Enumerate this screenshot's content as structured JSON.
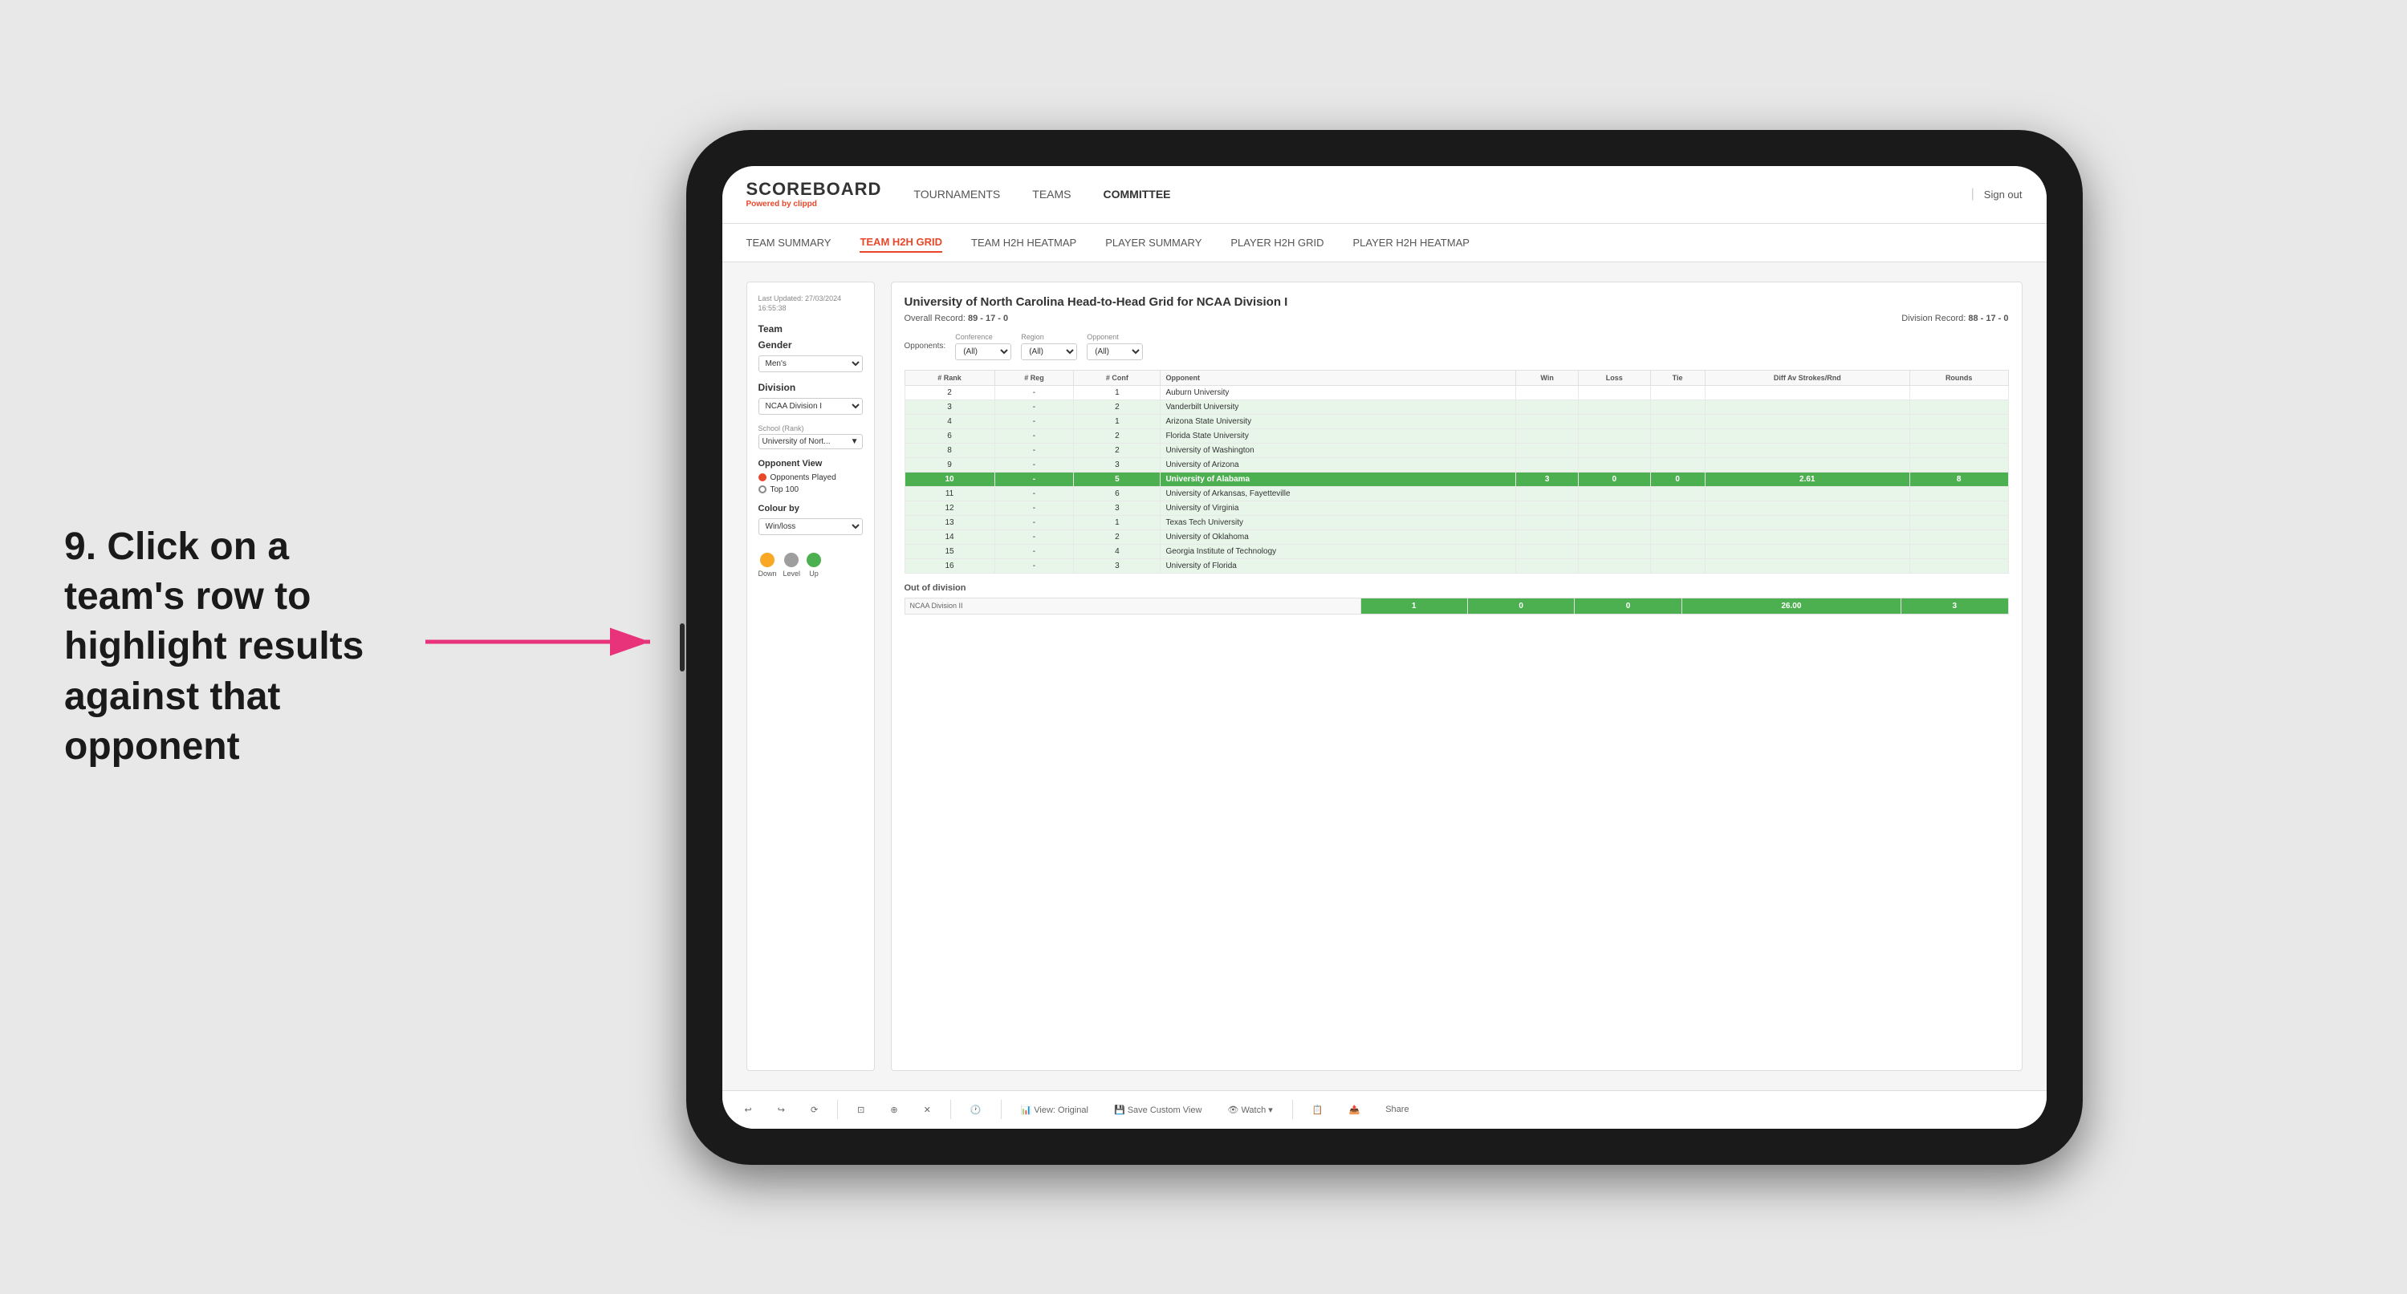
{
  "annotation": {
    "text": "9. Click on a team's row to highlight results against that opponent"
  },
  "app": {
    "logo": {
      "scoreboard": "SCOREBOARD",
      "powered_by": "Powered by",
      "brand": "clippd"
    },
    "nav": [
      {
        "label": "TOURNAMENTS",
        "active": false
      },
      {
        "label": "TEAMS",
        "active": false
      },
      {
        "label": "COMMITTEE",
        "active": false
      }
    ],
    "sign_out": "Sign out",
    "sub_nav": [
      {
        "label": "TEAM SUMMARY",
        "active": false
      },
      {
        "label": "TEAM H2H GRID",
        "active": true
      },
      {
        "label": "TEAM H2H HEATMAP",
        "active": false
      },
      {
        "label": "PLAYER SUMMARY",
        "active": false
      },
      {
        "label": "PLAYER H2H GRID",
        "active": false
      },
      {
        "label": "PLAYER H2H HEATMAP",
        "active": false
      }
    ]
  },
  "left_panel": {
    "last_updated_label": "Last Updated: 27/03/2024",
    "last_updated_time": "16:55:38",
    "team_label": "Team",
    "gender_label": "Gender",
    "gender_value": "Men's",
    "division_label": "Division",
    "division_value": "NCAA Division I",
    "school_label": "School (Rank)",
    "school_value": "University of Nort...",
    "opponent_view_label": "Opponent View",
    "radio_options": [
      {
        "label": "Opponents Played",
        "selected": true
      },
      {
        "label": "Top 100",
        "selected": false
      }
    ],
    "colour_by_label": "Colour by",
    "colour_by_value": "Win/loss",
    "legend": [
      {
        "label": "Down",
        "color": "#f9a825"
      },
      {
        "label": "Level",
        "color": "#9e9e9e"
      },
      {
        "label": "Up",
        "color": "#4caf50"
      }
    ]
  },
  "grid": {
    "title": "University of North Carolina Head-to-Head Grid for NCAA Division I",
    "overall_record_label": "Overall Record:",
    "overall_record": "89 - 17 - 0",
    "division_record_label": "Division Record:",
    "division_record": "88 - 17 - 0",
    "filters": {
      "opponents_label": "Opponents:",
      "conference_label": "Conference",
      "conference_value": "(All)",
      "region_label": "Region",
      "region_value": "(All)",
      "opponent_label": "Opponent",
      "opponent_value": "(All)"
    },
    "table_headers": [
      "# Rank",
      "# Reg",
      "# Conf",
      "Opponent",
      "Win",
      "Loss",
      "Tie",
      "Diff Av Strokes/Rnd",
      "Rounds"
    ],
    "rows": [
      {
        "rank": "2",
        "reg": "-",
        "conf": "1",
        "opponent": "Auburn University",
        "win": "",
        "loss": "",
        "tie": "",
        "diff": "",
        "rounds": "",
        "style": "normal-row"
      },
      {
        "rank": "3",
        "reg": "-",
        "conf": "2",
        "opponent": "Vanderbilt University",
        "win": "",
        "loss": "",
        "tie": "",
        "diff": "",
        "rounds": "",
        "style": "win-row"
      },
      {
        "rank": "4",
        "reg": "-",
        "conf": "1",
        "opponent": "Arizona State University",
        "win": "",
        "loss": "",
        "tie": "",
        "diff": "",
        "rounds": "",
        "style": "win-row"
      },
      {
        "rank": "6",
        "reg": "-",
        "conf": "2",
        "opponent": "Florida State University",
        "win": "",
        "loss": "",
        "tie": "",
        "diff": "",
        "rounds": "",
        "style": "win-row"
      },
      {
        "rank": "8",
        "reg": "-",
        "conf": "2",
        "opponent": "University of Washington",
        "win": "",
        "loss": "",
        "tie": "",
        "diff": "",
        "rounds": "",
        "style": "win-row"
      },
      {
        "rank": "9",
        "reg": "-",
        "conf": "3",
        "opponent": "University of Arizona",
        "win": "",
        "loss": "",
        "tie": "",
        "diff": "",
        "rounds": "",
        "style": "win-row"
      },
      {
        "rank": "10",
        "reg": "-",
        "conf": "5",
        "opponent": "University of Alabama",
        "win": "3",
        "loss": "0",
        "tie": "0",
        "diff": "2.61",
        "rounds": "8",
        "style": "selected-row"
      },
      {
        "rank": "11",
        "reg": "-",
        "conf": "6",
        "opponent": "University of Arkansas, Fayetteville",
        "win": "",
        "loss": "",
        "tie": "",
        "diff": "",
        "rounds": "",
        "style": "win-row"
      },
      {
        "rank": "12",
        "reg": "-",
        "conf": "3",
        "opponent": "University of Virginia",
        "win": "",
        "loss": "",
        "tie": "",
        "diff": "",
        "rounds": "",
        "style": "win-row"
      },
      {
        "rank": "13",
        "reg": "-",
        "conf": "1",
        "opponent": "Texas Tech University",
        "win": "",
        "loss": "",
        "tie": "",
        "diff": "",
        "rounds": "",
        "style": "win-row"
      },
      {
        "rank": "14",
        "reg": "-",
        "conf": "2",
        "opponent": "University of Oklahoma",
        "win": "",
        "loss": "",
        "tie": "",
        "diff": "",
        "rounds": "",
        "style": "win-row"
      },
      {
        "rank": "15",
        "reg": "-",
        "conf": "4",
        "opponent": "Georgia Institute of Technology",
        "win": "",
        "loss": "",
        "tie": "",
        "diff": "",
        "rounds": "",
        "style": "win-row"
      },
      {
        "rank": "16",
        "reg": "-",
        "conf": "3",
        "opponent": "University of Florida",
        "win": "",
        "loss": "",
        "tie": "",
        "diff": "",
        "rounds": "",
        "style": "win-row"
      }
    ],
    "out_of_division_label": "Out of division",
    "out_of_division_row": {
      "label": "NCAA Division II",
      "win": "1",
      "loss": "0",
      "tie": "0",
      "diff": "26.00",
      "rounds": "3"
    }
  },
  "toolbar": {
    "buttons": [
      {
        "label": "↩",
        "name": "undo"
      },
      {
        "label": "↪",
        "name": "redo"
      },
      {
        "label": "⟳",
        "name": "refresh"
      },
      {
        "label": "⊡",
        "name": "fit"
      },
      {
        "label": "⊕",
        "name": "add"
      },
      {
        "label": "✕",
        "name": "remove"
      },
      {
        "label": "🕐",
        "name": "clock"
      },
      {
        "label": "View: Original",
        "name": "view-original"
      },
      {
        "label": "💾 Save Custom View",
        "name": "save-view"
      },
      {
        "label": "👁 Watch ▾",
        "name": "watch"
      },
      {
        "label": "📋",
        "name": "clipboard"
      },
      {
        "label": "📤",
        "name": "export"
      },
      {
        "label": "Share",
        "name": "share"
      }
    ]
  }
}
